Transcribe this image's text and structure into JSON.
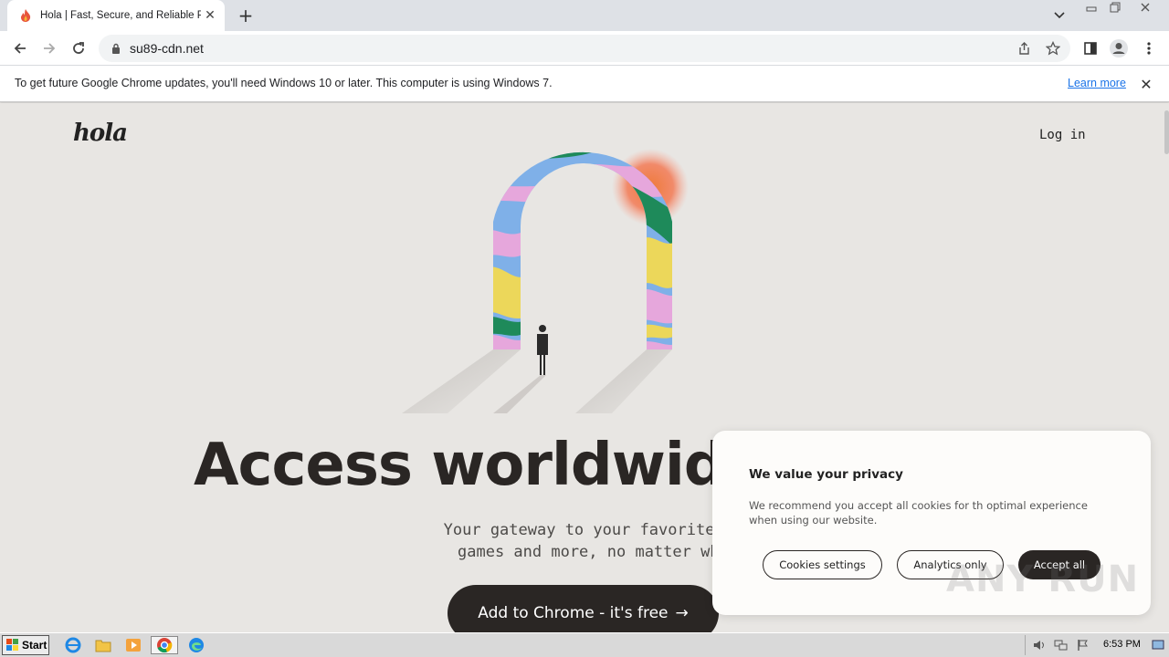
{
  "browser": {
    "tab": {
      "title": "Hola | Fast, Secure, and Reliable Pro"
    },
    "address": {
      "url": "su89-cdn.net"
    }
  },
  "infobar": {
    "message": "To get future Google Chrome updates, you'll need Windows 10 or later. This computer is using Windows 7.",
    "link": "Learn more"
  },
  "page": {
    "logo": "hola",
    "login": "Log in",
    "headline": "Access worldwide",
    "sub_line1": "Your gateway to your favorite movies,",
    "sub_line2": "games and more, no matter where yo",
    "cta": "Add to Chrome - it's free"
  },
  "cookie": {
    "title": "We value your privacy",
    "text": "We recommend you accept all cookies for th optimal experience when using our website.",
    "settings": "Cookies settings",
    "analytics": "Analytics only",
    "accept": "Accept all"
  },
  "watermark": "ANY RUN",
  "taskbar": {
    "start": "Start",
    "clock": "6:53 PM"
  },
  "colors": {
    "accent_dark": "#2a2624",
    "page_bg": "#e8e6e3",
    "link_blue": "#1a73e8"
  }
}
